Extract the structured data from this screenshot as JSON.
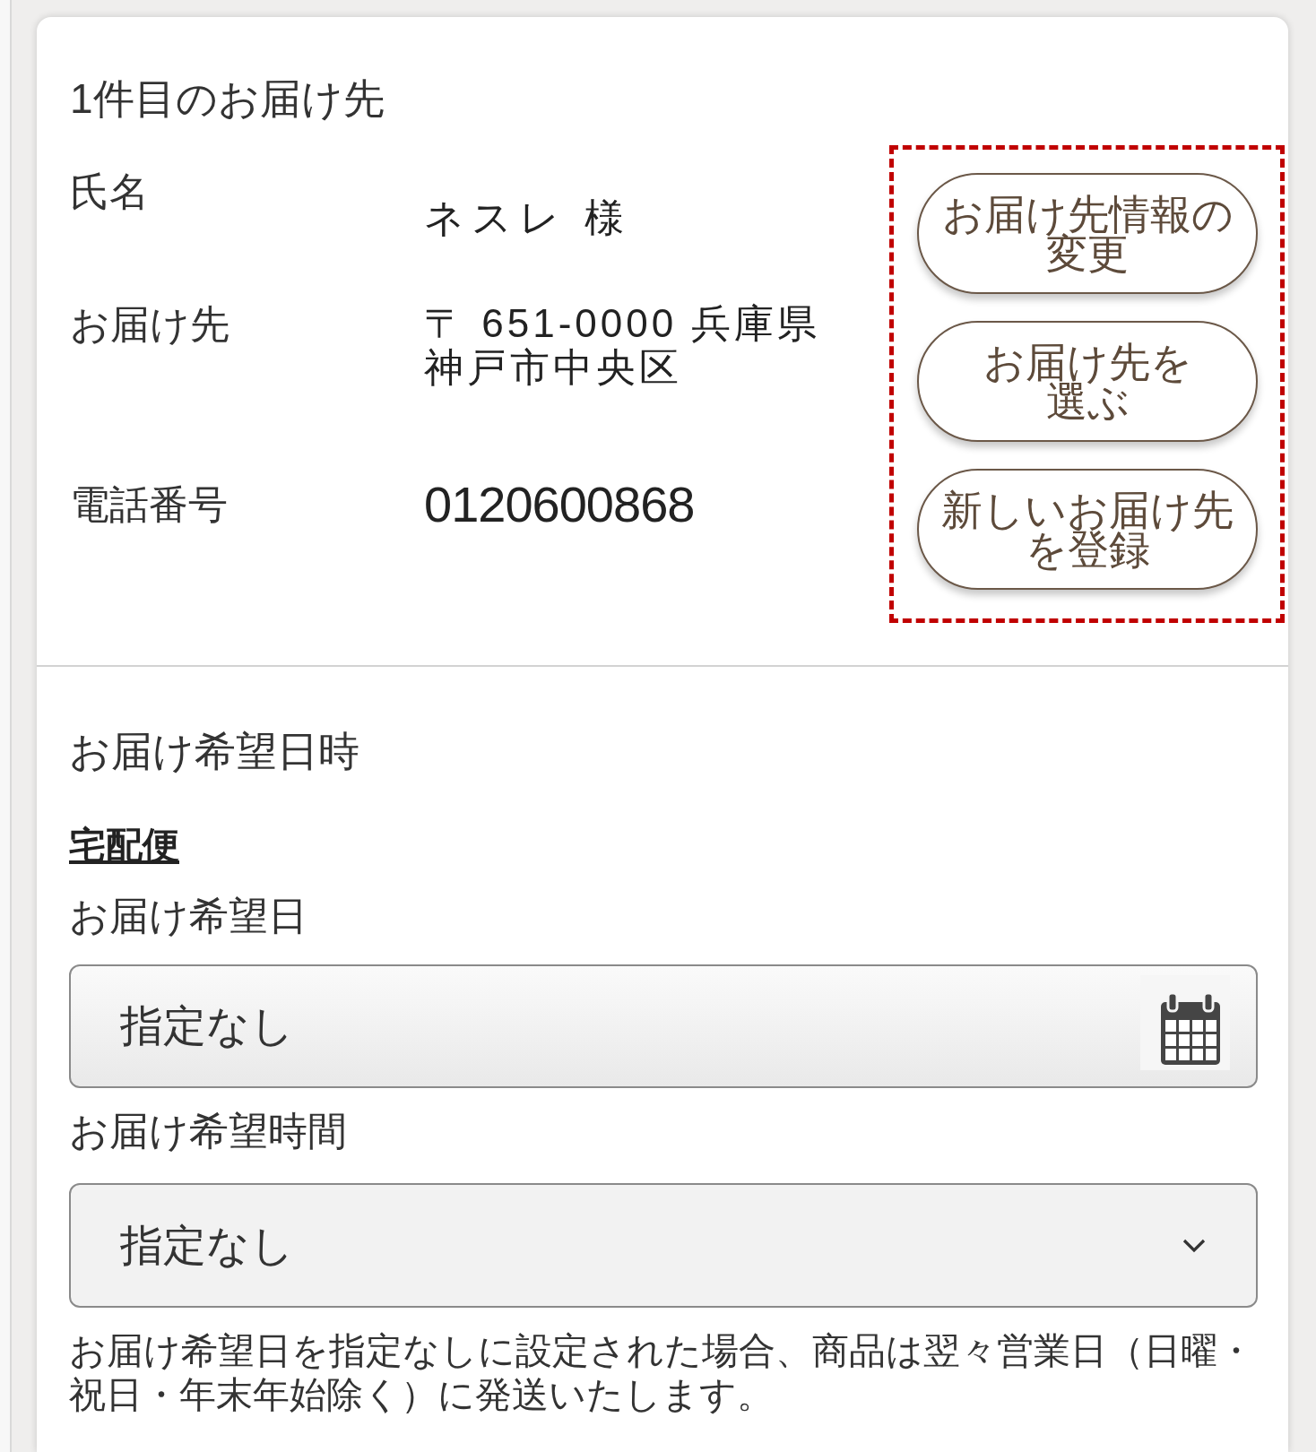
{
  "delivery_address": {
    "title": "1件目のお届け先",
    "rows": [
      {
        "kind": "name",
        "label": "氏名",
        "lines": [
          "ネスレ 様"
        ]
      },
      {
        "kind": "address",
        "label": "お届け先",
        "lines": [
          "〒 651-0000 兵庫県",
          "神戸市中央区"
        ]
      },
      {
        "kind": "phone",
        "label": "電話番号",
        "lines": [
          "0120600868"
        ]
      }
    ]
  },
  "address_actions": {
    "highlighted": true,
    "buttons": [
      {
        "label_lines": [
          "お届け先情報の",
          "変更"
        ]
      },
      {
        "label_lines": [
          "お届け先を",
          "選ぶ"
        ]
      },
      {
        "label_lines": [
          "新しいお届け先",
          "を登録"
        ]
      }
    ]
  },
  "delivery_schedule": {
    "title": "お届け希望日時",
    "method": "宅配便",
    "fields": [
      {
        "kind": "date",
        "label": "お届け希望日",
        "value": "指定なし"
      },
      {
        "kind": "select",
        "label": "お届け希望時間",
        "value": "指定なし"
      }
    ],
    "note": "お届け希望日を指定なしに設定された場合、商品は翌々営業日（日曜・祝日・年末年始除く）に発送いたします。"
  }
}
